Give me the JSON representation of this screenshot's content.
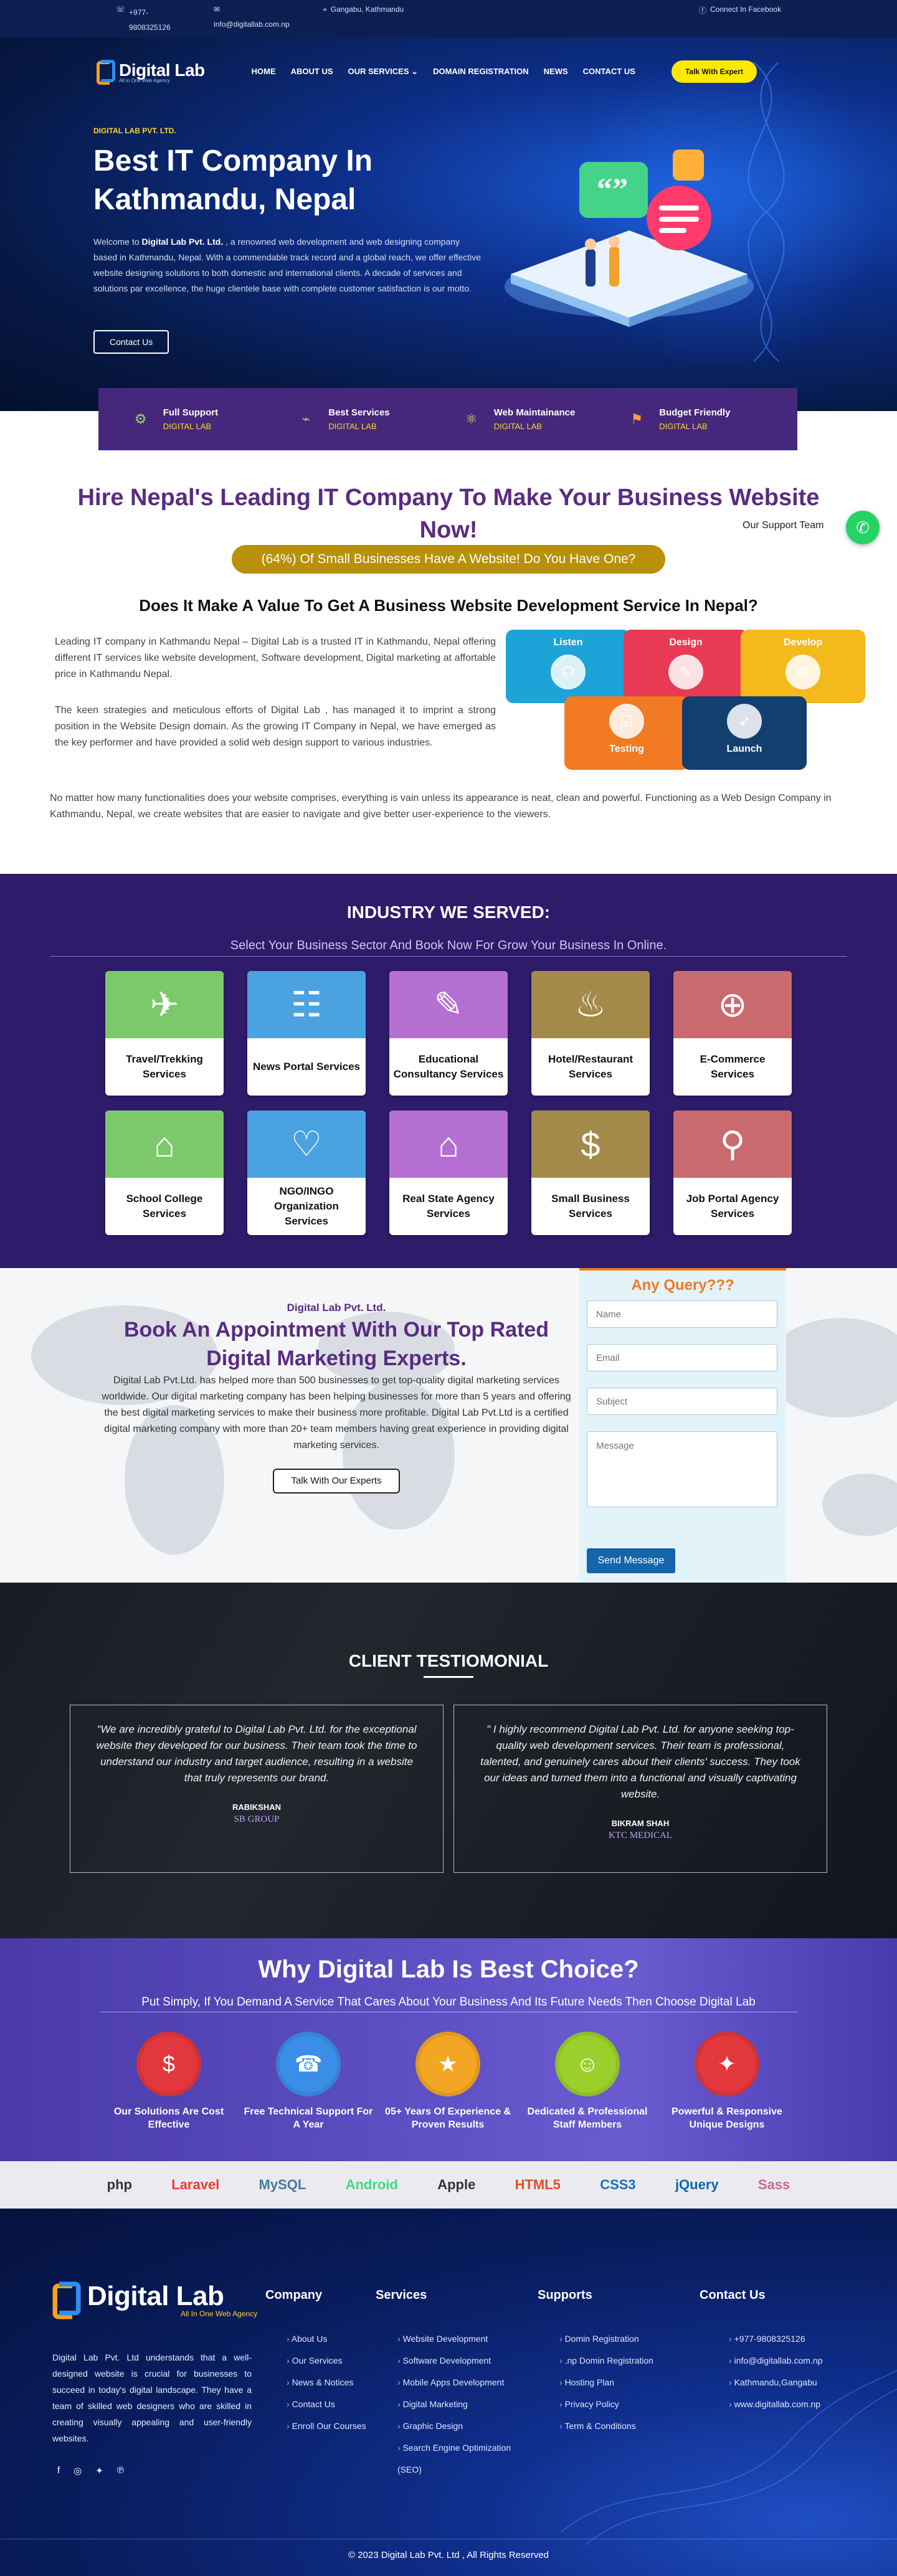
{
  "topbar": {
    "phone": "+977-9808325126",
    "email": "info@digitallab.com.np",
    "location": "Gangabu, Kathmandu",
    "facebook": "Connect In Facebook"
  },
  "nav": {
    "logo": "Digital Lab",
    "logo_tagline": "All in One Web Agency",
    "items": [
      "HOME",
      "ABOUT US",
      "OUR SERVICES",
      "DOMAIN REGISTRATION",
      "NEWS",
      "CONTACT US"
    ],
    "cta": "Talk With Expert"
  },
  "hero": {
    "tag": "DIGITAL LAB PVT. LTD.",
    "title": "Best IT Company In Kathmandu, Nepal",
    "desc_prefix": "Welcome to ",
    "desc_brand": "Digital Lab Pvt. Ltd.",
    "desc_rest": " , a renowned web development and web designing company based in Kathmandu, Nepal. With a commendable track record and a global reach, we offer effective website designing solutions to both domestic and international clients. A decade of services and solutions par excellence, the huge clientele base with complete customer satisfaction is our motto.",
    "cta": "Contact Us"
  },
  "features": [
    {
      "title": "Full Support",
      "sub": "DIGITAL LAB",
      "icon": "support-icon"
    },
    {
      "title": "Best Services",
      "sub": "DIGITAL LAB",
      "icon": "services-icon"
    },
    {
      "title": "Web Maintainance",
      "sub": "DIGITAL LAB",
      "icon": "maintenance-icon"
    },
    {
      "title": "Budget Friendly",
      "sub": "DIGITAL LAB",
      "icon": "budget-icon"
    }
  ],
  "hire": {
    "title": "Hire Nepal's Leading IT Company To Make Your Business Website Now!",
    "pill": "(64%) Of Small Businesses Have A Website! Do You Have One?",
    "subtitle": "Does It Make A Value To Get A Business Website Development Service In Nepal?",
    "p1": "Leading IT company in Kathmandu Nepal – Digital Lab is a trusted IT  in Kathmandu, Nepal offering different IT services like website development, Software development, Digital marketing at affortable price  in Kathmandu Nepal.",
    "p2": "The keen strategies and meticulous efforts of Digital Lab , has managed it to imprint a strong position in the Website Design domain. As the growing IT Company in Nepal, we have emerged as the key performer and have provided a solid web design support to various industries.",
    "p3": "No matter how many functionalities does your website comprises, everything is vain unless its appearance is neat, clean and powerful. Functioning as a Web Design Company in Kathmandu, Nepal, we create websites that are easier to navigate and give better user-experience to the viewers.",
    "process": [
      {
        "label": "Listen",
        "color": "#1ea3d8"
      },
      {
        "label": "Design",
        "color": "#e93a55"
      },
      {
        "label": "Develop",
        "color": "#f4b91a"
      },
      {
        "label": "Testing",
        "color": "#f27a22"
      },
      {
        "label": "Launch",
        "color": "#123f6e"
      }
    ],
    "support": "Our Support Team"
  },
  "industry": {
    "title": "INDUSTRY WE SERVED:",
    "subtitle": "Select Your Business Sector And Book Now For Grow Your Business In Online.",
    "cards": [
      {
        "label": "Travel/Trekking Services",
        "color": "#7cc96b",
        "icon": "travel-icon",
        "glyph": "✈"
      },
      {
        "label": "News Portal Services",
        "color": "#4aa3e0",
        "icon": "news-icon",
        "glyph": "☷"
      },
      {
        "label": "Educational Consultancy Services",
        "color": "#b56fd3",
        "icon": "education-icon",
        "glyph": "✎"
      },
      {
        "label": "Hotel/Restaurant Services",
        "color": "#a48a4a",
        "icon": "hotel-icon",
        "glyph": "♨"
      },
      {
        "label": "E-Commerce Services",
        "color": "#c96a6e",
        "icon": "ecommerce-icon",
        "glyph": "⊕"
      },
      {
        "label": "School College Services",
        "color": "#7cc96b",
        "icon": "school-icon",
        "glyph": "⌂"
      },
      {
        "label": "NGO/INGO Organization Services",
        "color": "#4aa3e0",
        "icon": "ngo-icon",
        "glyph": "♡"
      },
      {
        "label": "Real State Agency Services",
        "color": "#b56fd3",
        "icon": "realestate-icon",
        "glyph": "⌂"
      },
      {
        "label": "Small Business Services",
        "color": "#a48a4a",
        "icon": "small-business-icon",
        "glyph": "$"
      },
      {
        "label": "Job Portal Agency Services",
        "color": "#c96a6e",
        "icon": "job-portal-icon",
        "glyph": "⚲"
      }
    ]
  },
  "appointment": {
    "tag": "Digital Lab Pvt. Ltd.",
    "title": "Book An Appointment With Our Top Rated Digital Marketing Experts.",
    "desc": "Digital Lab Pvt.Ltd. has helped more than 500 businesses to get top-quality digital marketing services worldwide. Our digital marketing company has been helping businesses for more than 5 years and offering the best digital marketing services to make their business more profitable. Digital Lab Pvt.Ltd is a certified digital marketing company with more than 20+ team members having great experience in providing digital marketing services.",
    "cta": "Talk With Our Experts",
    "form": {
      "title": "Any Query???",
      "name": "Name",
      "email": "Email",
      "subject": "Subject",
      "message": "Message",
      "send": "Send Message"
    }
  },
  "testimonial": {
    "title": "CLIENT TESTIOMONIAL",
    "items": [
      {
        "quote": "\"We are incredibly grateful to Digital Lab Pvt. Ltd. for the exceptional website they developed for our business. Their team took the time to understand our industry and target audience, resulting in a website that truly represents our brand.",
        "name": "RABIKSHAN",
        "org": "SB GROUP"
      },
      {
        "quote": "\" I highly recommend Digital Lab Pvt. Ltd. for anyone seeking top-quality web development services. Their team is professional, talented, and genuinely cares about their clients' success. They took our ideas and turned them into a functional and visually captivating website.",
        "name": "BIKRAM SHAH",
        "org": "KTC MEDICAL"
      }
    ]
  },
  "why": {
    "title": "Why Digital Lab Is Best Choice?",
    "subtitle": "Put Simply, If You Demand A Service That Cares About Your Business And Its Future Needs Then Choose Digital Lab",
    "items": [
      {
        "label": "Our Solutions Are Cost Effective",
        "color": "#e2383c",
        "icon": "cost-icon",
        "glyph": "$"
      },
      {
        "label": "Free Technical Support For A Year",
        "color": "#3b8ee8",
        "icon": "technical-support-icon",
        "glyph": "☎"
      },
      {
        "label": "05+ Years Of Experience & Proven Results",
        "color": "#f2a623",
        "icon": "experience-icon",
        "glyph": "★"
      },
      {
        "label": "Dedicated & Professional Staff Members",
        "color": "#9bcf2c",
        "icon": "staff-icon",
        "glyph": "☺"
      },
      {
        "label": "Powerful & Responsive Unique Designs",
        "color": "#e2383c",
        "icon": "design-icon",
        "glyph": "✦"
      }
    ]
  },
  "tech": [
    {
      "label": "php",
      "color": "#333333",
      "icon": "php-logo"
    },
    {
      "label": "Laravel",
      "color": "#ef3b2d",
      "icon": "laravel-logo"
    },
    {
      "label": "MySQL",
      "color": "#4479a1",
      "icon": "mysql-logo"
    },
    {
      "label": "Android",
      "color": "#3ddc84",
      "icon": "android-logo"
    },
    {
      "label": "Apple",
      "color": "#333333",
      "icon": "apple-logo"
    },
    {
      "label": "HTML5",
      "color": "#e34f26",
      "icon": "html5-logo"
    },
    {
      "label": "CSS3",
      "color": "#1572b6",
      "icon": "css3-logo"
    },
    {
      "label": "jQuery",
      "color": "#0769ad",
      "icon": "jquery-logo"
    },
    {
      "label": "Sass",
      "color": "#cc6699",
      "icon": "sass-logo"
    }
  ],
  "footer": {
    "logo": "Digital Lab",
    "logo_tagline": "All In One Web Agency",
    "about": "Digital Lab Pvt. Ltd understands that a well-designed website is crucial for businesses to succeed in today's digital landscape. They have a team of skilled web designers who are skilled in creating visually appealing and user-friendly websites.",
    "company_heading": "Company",
    "company": [
      "About Us",
      "Our Services",
      "News & Notices",
      "Contact Us",
      "Enroll Our Courses"
    ],
    "services_heading": "Services",
    "services": [
      "Website Development",
      "Software Development",
      "Mobile Apps Development",
      "Digital Marketing",
      "Graphic Design",
      "Search Engine Optimization (SEO)"
    ],
    "supports_heading": "Supports",
    "supports": [
      "Domin Registration",
      ".np Domin Registration",
      "Hosting Plan",
      "Privacy Policy",
      "Term & Conditions"
    ],
    "contact_heading": "Contact Us",
    "contact": [
      "+977-9808325126",
      "info@digitallab.com.np",
      "Kathmandu,Gangabu",
      "www.digitallab.com.np"
    ],
    "copyright": "© 2023 Digital Lab Pvt. Ltd , All Rights Reserved"
  }
}
